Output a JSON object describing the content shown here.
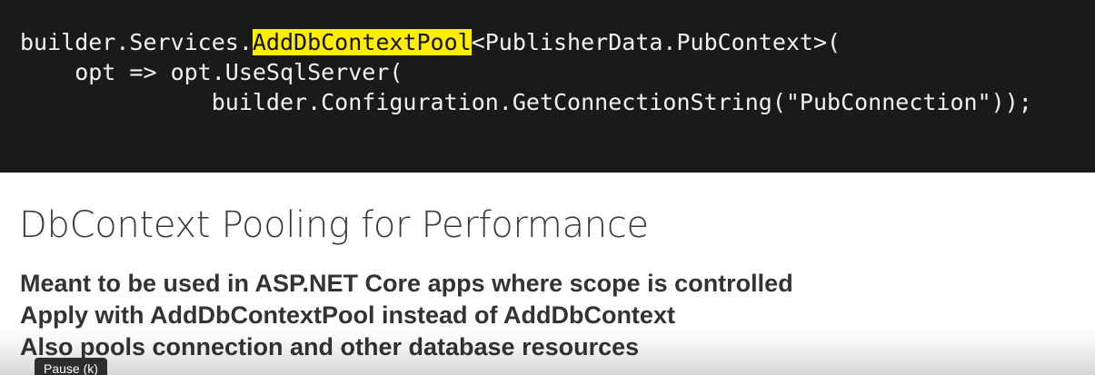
{
  "code": {
    "line1": {
      "prefix": "builder.Services.",
      "highlight": "AddDbContextPool",
      "suffix": "<PublisherData.PubContext>("
    },
    "line2": "    opt => opt.UseSqlServer(",
    "line3": "              builder.Configuration.GetConnectionString(\"PubConnection\"));"
  },
  "slide": {
    "title": "DbContext Pooling for Performance",
    "bullets": [
      "Meant to be used in ASP.NET Core apps where scope is controlled",
      "Apply with AddDbContextPool instead of AddDbContext",
      "Also pools connection and other database resources"
    ]
  },
  "player": {
    "tooltip": "Pause (k)"
  },
  "colors": {
    "code_background": "#1a1a1a",
    "code_text": "#f2f2f2",
    "highlight": "#ffee00",
    "slide_background": "#ffffff",
    "title_text": "#3a3a3a",
    "bullet_text": "#333333"
  }
}
